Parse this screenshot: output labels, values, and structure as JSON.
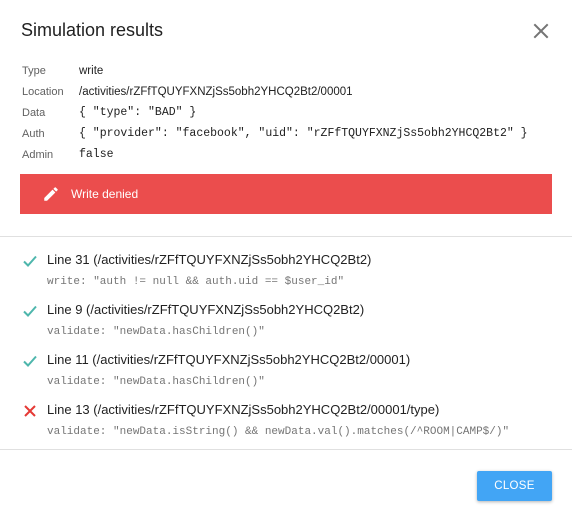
{
  "dialog": {
    "title": "Simulation results",
    "close_label": "CLOSE"
  },
  "meta": [
    {
      "key": "Type",
      "value": "write",
      "mono": false
    },
    {
      "key": "Location",
      "value": "/activities/rZFfTQUYFXNZjSs5obh2YHCQ2Bt2/00001",
      "mono": false
    },
    {
      "key": "Data",
      "value": "{ \"type\": \"BAD\" }",
      "mono": true
    },
    {
      "key": "Auth",
      "value": "{ \"provider\": \"facebook\", \"uid\": \"rZFfTQUYFXNZjSs5obh2YHCQ2Bt2\" }",
      "mono": true
    },
    {
      "key": "Admin",
      "value": "false",
      "mono": true
    }
  ],
  "banner": {
    "text": "Write denied",
    "icon": "pencil-icon",
    "color": "#eb4d4d"
  },
  "results": [
    {
      "status": "pass",
      "icon": "check-icon",
      "line": "Line 31 (/activities/rZFfTQUYFXNZjSs5obh2YHCQ2Bt2)",
      "rule": "write: \"auth != null && auth.uid == $user_id\""
    },
    {
      "status": "pass",
      "icon": "check-icon",
      "line": "Line 9 (/activities/rZFfTQUYFXNZjSs5obh2YHCQ2Bt2)",
      "rule": "validate: \"newData.hasChildren()\""
    },
    {
      "status": "pass",
      "icon": "check-icon",
      "line": "Line 11 (/activities/rZFfTQUYFXNZjSs5obh2YHCQ2Bt2/00001)",
      "rule": "validate: \"newData.hasChildren()\""
    },
    {
      "status": "fail",
      "icon": "cross-icon",
      "line": "Line 13 (/activities/rZFfTQUYFXNZjSs5obh2YHCQ2Bt2/00001/type)",
      "rule": "validate: \"newData.isString() && newData.val().matches(/^ROOM|CAMP$/)\""
    }
  ],
  "colors": {
    "pass": "#4db6ac",
    "fail": "#e53935",
    "button": "#42a5f5"
  }
}
